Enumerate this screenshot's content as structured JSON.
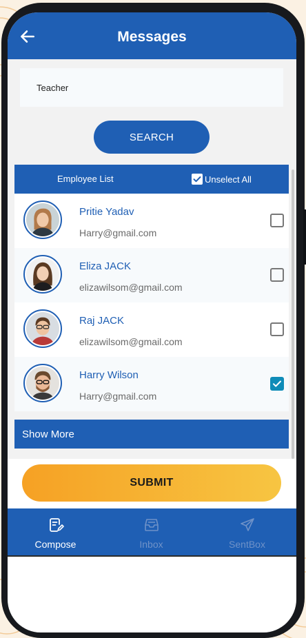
{
  "header": {
    "title": "Messages",
    "back_icon": "arrow-left-icon"
  },
  "search": {
    "value": "Teacher",
    "button_label": "SEARCH"
  },
  "employee_list": {
    "title": "Employee List",
    "unselect_label": "Unselect All",
    "unselect_checked": true,
    "items": [
      {
        "name": "Pritie Yadav",
        "email": "Harry@gmail.com",
        "checked": false
      },
      {
        "name": "Eliza JACK",
        "email": "elizawilsom@gmail.com",
        "checked": false
      },
      {
        "name": "Raj JACK",
        "email": "elizawilsom@gmail.com",
        "checked": false
      },
      {
        "name": "Harry Wilson",
        "email": "Harry@gmail.com",
        "checked": true
      }
    ],
    "show_more_label": "Show More"
  },
  "submit_label": "SUBMIT",
  "tabs": [
    {
      "label": "Compose",
      "icon": "compose-icon",
      "active": true
    },
    {
      "label": "Inbox",
      "icon": "inbox-icon",
      "active": false
    },
    {
      "label": "SentBox",
      "icon": "send-icon",
      "active": false
    }
  ],
  "colors": {
    "primary": "#1f5fb4",
    "accent": "#f6a124",
    "check": "#0f8cb8"
  }
}
